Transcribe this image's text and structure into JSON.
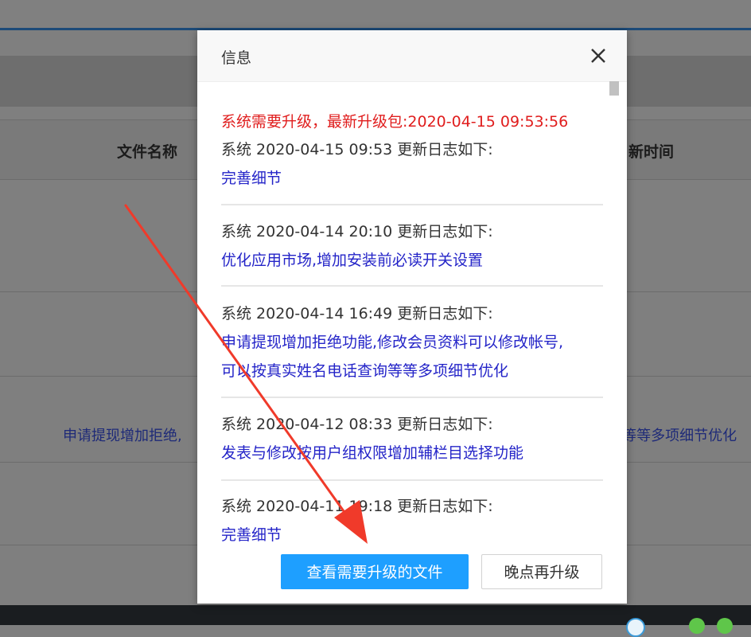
{
  "background": {
    "table_headers": [
      "文件名称",
      "新时间"
    ],
    "row_text_left": "申请提现增加拒绝,",
    "row_text_right": "|等等多项细节优化"
  },
  "modal": {
    "title": "信息",
    "close_icon": "close-icon",
    "upgrade_notice": "系统需要升级，最新升级包:2020-04-15 09:53:56",
    "entries": [
      {
        "title": "系统 2020-04-15 09:53 更新日志如下:",
        "details": [
          "完善细节"
        ]
      },
      {
        "title": "系统 2020-04-14 20:10 更新日志如下:",
        "details": [
          "优化应用市场,增加安装前必读开关设置"
        ]
      },
      {
        "title": "系统 2020-04-14 16:49 更新日志如下:",
        "details": [
          "申请提现增加拒绝功能,修改会员资料可以修改帐号,",
          "可以按真实姓名电话查询等等多项细节优化"
        ]
      },
      {
        "title": "系统 2020-04-12 08:33 更新日志如下:",
        "details": [
          "发表与修改按用户组权限增加辅栏目选择功能"
        ]
      },
      {
        "title": "系统 2020-04-11 19:18 更新日志如下:",
        "details": [
          "完善细节"
        ]
      }
    ],
    "buttons": {
      "view_files": "查看需要升级的文件",
      "later": "晚点再升级"
    }
  },
  "colors": {
    "notice_red": "#e01d1d",
    "detail_blue": "#2424c8",
    "primary_button": "#1e9fff",
    "overlay": "#7f7f7f",
    "annotation_arrow": "#f03a2a"
  }
}
